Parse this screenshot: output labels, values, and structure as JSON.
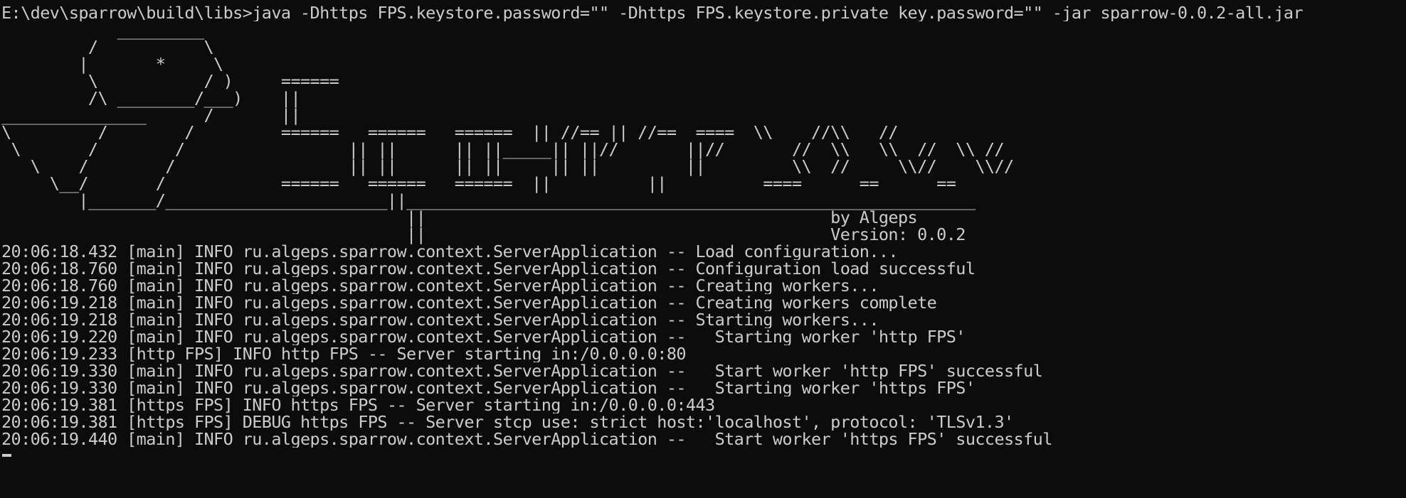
{
  "command": "E:\\dev\\sparrow\\build\\libs>java -Dhttps_FPS.keystore.password=\"\" -Dhttps_FPS.keystore.private_key.password=\"\" -jar sparrow-0.0.2-all.jar",
  "banner": "            _________\n         /           \\\n        |       *     \\\n         \\           / )     ======\n         /\\ ________/___)    ||\n_______________      /       ||\n\\         /        /         ======   ======   ======  || //== || //==  ====  \\\\    //\\\\   //\n \\       /        /                 || ||      || ||_____|| ||//       ||//       //  \\\\   \\\\  //  \\\\ //\n   \\    /        /                  || ||      || ||     || ||         ||         \\\\  //     \\\\//    \\\\//\n     \\__/       /            ======   ======   ======  ||          ||          ====      ==      ==\n        |_______/_______________________||___________________________________________________________\n                                          ||                                          by Algeps\n                                          ||                                          Version: 0.0.2",
  "log_lines": [
    "20:06:18.432 [main] INFO ru.algeps.sparrow.context.ServerApplication -- Load configuration...",
    "20:06:18.760 [main] INFO ru.algeps.sparrow.context.ServerApplication -- Configuration load successful",
    "20:06:18.760 [main] INFO ru.algeps.sparrow.context.ServerApplication -- Creating workers...",
    "20:06:19.218 [main] INFO ru.algeps.sparrow.context.ServerApplication -- Creating workers complete",
    "20:06:19.218 [main] INFO ru.algeps.sparrow.context.ServerApplication -- Starting workers...",
    "20:06:19.220 [main] INFO ru.algeps.sparrow.context.ServerApplication --   Starting worker 'http FPS'",
    "20:06:19.233 [http FPS] INFO http FPS -- Server starting in:/0.0.0.0:80",
    "20:06:19.330 [main] INFO ru.algeps.sparrow.context.ServerApplication --   Start worker 'http FPS' successful",
    "20:06:19.330 [main] INFO ru.algeps.sparrow.context.ServerApplication --   Starting worker 'https FPS'",
    "20:06:19.381 [https FPS] INFO https FPS -- Server starting in:/0.0.0.0:443",
    "20:06:19.381 [https FPS] DEBUG https FPS -- Server stcp use: strict host:'localhost', protocol: 'TLSv1.3'",
    "20:06:19.440 [main] INFO ru.algeps.sparrow.context.ServerApplication --   Start worker 'https FPS' successful"
  ],
  "colors": {
    "background": "#0c0c0c",
    "foreground": "#cccccc"
  }
}
